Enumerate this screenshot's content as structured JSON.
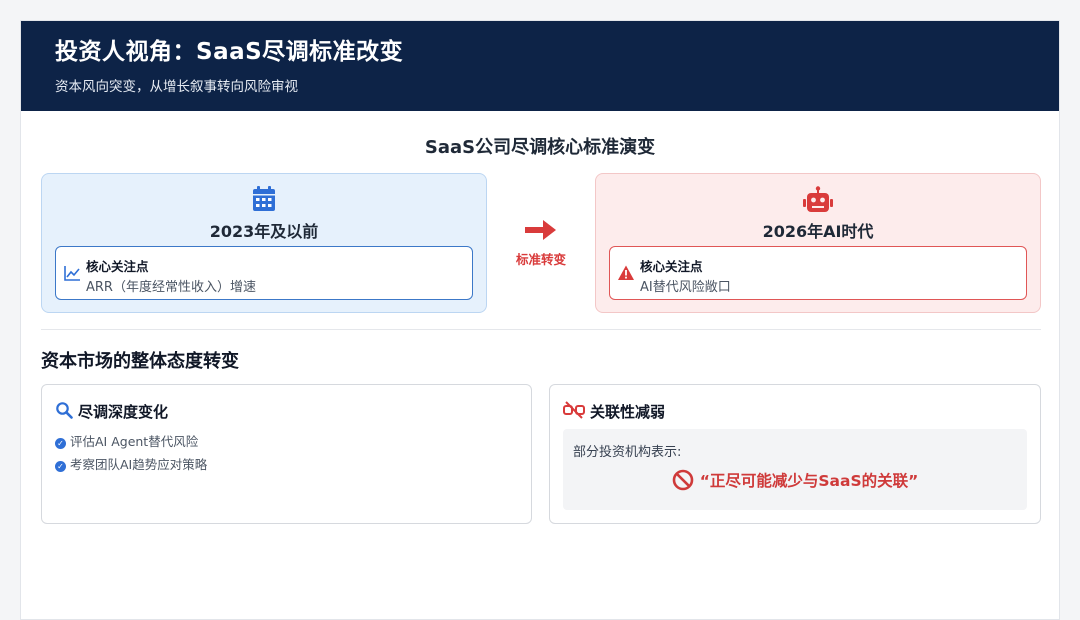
{
  "header": {
    "title": "投资人视角：SaaS尽调标准改变",
    "subtitle": "资本风向突变，从增长叙事转向风险审视"
  },
  "evolution": {
    "title": "SaaS公司尽调核心标准演变",
    "before": {
      "icon": "calendar-icon",
      "title": "2023年及以前",
      "focus_label": "核心关注点",
      "focus_value": "ARR（年度经常性收入）增速"
    },
    "transition_label": "标准转变",
    "after": {
      "icon": "robot-icon",
      "title": "2026年AI时代",
      "focus_label": "核心关注点",
      "focus_value": "AI替代风险敞口"
    }
  },
  "market": {
    "title": "资本市场的整体态度转变",
    "diligence": {
      "title": "尽调深度变化",
      "items": [
        "评估AI Agent替代风险",
        "考察团队AI趋势应对策略"
      ]
    },
    "association": {
      "title": "关联性减弱",
      "quote_label": "部分投资机构表示:",
      "quote": "“正尽可能减少与SaaS的关联”"
    }
  },
  "colors": {
    "header_bg": "#0d2347",
    "accent_blue": "#2f6fd6",
    "accent_red": "#d93b3b"
  }
}
